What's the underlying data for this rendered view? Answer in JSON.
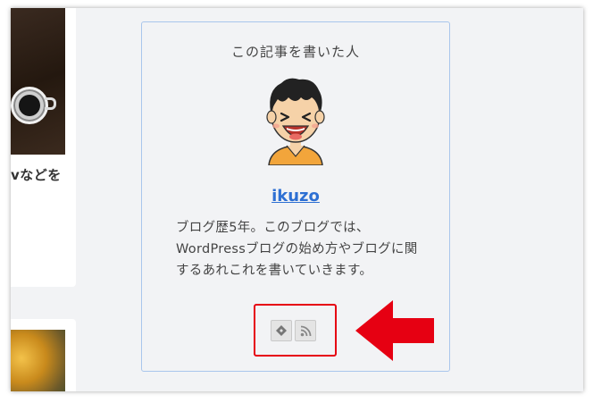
{
  "author_box": {
    "heading": "この記事を書いた人",
    "name": "ikuzo",
    "description": "ブログ歴5年。このブログでは、WordPressブログの始め方やブログに関するあれこれを書いていきます。",
    "sns_icons": [
      "feedly-icon",
      "rss-icon"
    ]
  },
  "left_column": {
    "card_title_fragment": "vなどを"
  },
  "annotation": {
    "highlight_color": "#e60012",
    "arrow_color": "#e60012"
  },
  "colors": {
    "link": "#2d6fd3",
    "box_border": "#a9c6ec",
    "background": "#f2f3f5"
  }
}
